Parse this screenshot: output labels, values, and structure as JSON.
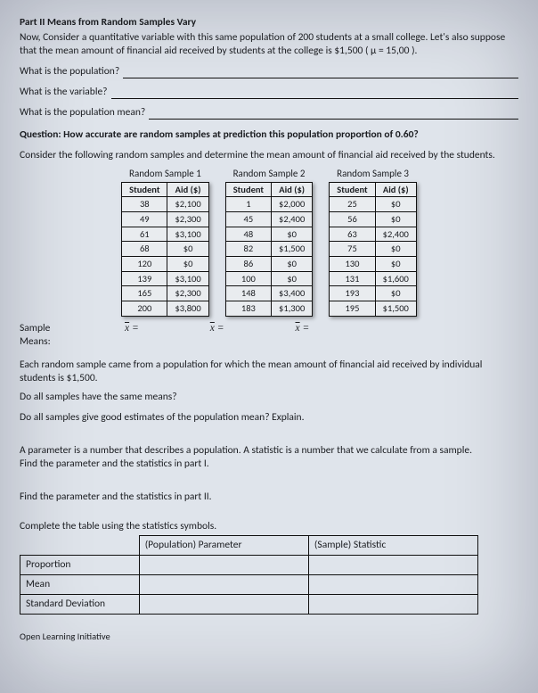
{
  "title": "Part II Means from Random Samples Vary",
  "intro": "Now, Consider a quantitative variable with this same population of 200 students at a small college. Let's also suppose that the mean amount of financial aid received by students at the college is $1,500 ( μ = 15,00 ).",
  "prompts": {
    "p1": "What is the population?",
    "p2": "What is the variable?",
    "p3": "What is the population mean?"
  },
  "question": "Question: How accurate are random samples at prediction this population proportion of 0.60?",
  "consider": "Consider the following random samples and determine the mean amount of financial aid received by the students.",
  "sampleTitles": {
    "t1": "Random Sample 1",
    "t2": "Random Sample 2",
    "t3": "Random Sample 3"
  },
  "headers": {
    "student": "Student",
    "aid": "Aid ($)"
  },
  "sample1": [
    {
      "s": "38",
      "a": "$2,100"
    },
    {
      "s": "49",
      "a": "$2,300"
    },
    {
      "s": "61",
      "a": "$3,100"
    },
    {
      "s": "68",
      "a": "$0"
    },
    {
      "s": "120",
      "a": "$0"
    },
    {
      "s": "139",
      "a": "$3,100"
    },
    {
      "s": "165",
      "a": "$2,300"
    },
    {
      "s": "200",
      "a": "$3,800"
    }
  ],
  "sample2": [
    {
      "s": "1",
      "a": "$2,000"
    },
    {
      "s": "45",
      "a": "$2,400"
    },
    {
      "s": "48",
      "a": "$0"
    },
    {
      "s": "82",
      "a": "$1,500"
    },
    {
      "s": "86",
      "a": "$0"
    },
    {
      "s": "100",
      "a": "$0"
    },
    {
      "s": "148",
      "a": "$3,400"
    },
    {
      "s": "183",
      "a": "$1,300"
    }
  ],
  "sample3": [
    {
      "s": "25",
      "a": "$0"
    },
    {
      "s": "56",
      "a": "$0"
    },
    {
      "s": "63",
      "a": "$2,400"
    },
    {
      "s": "75",
      "a": "$0"
    },
    {
      "s": "130",
      "a": "$0"
    },
    {
      "s": "131",
      "a": "$1,600"
    },
    {
      "s": "193",
      "a": "$0"
    },
    {
      "s": "195",
      "a": "$1,500"
    }
  ],
  "meansLabels": {
    "sample": "Sample",
    "means": "Means:",
    "eq": " ="
  },
  "notes": {
    "n1": "Each random sample came from a population for which the mean amount of financial aid received by individual students is $1,500.",
    "q1": "Do all samples have the same means?",
    "q2": "Do all samples give good estimates of the population mean? Explain.",
    "paramdef": "A parameter is a number that describes a population.  A statistic is a number that we calculate from a sample.",
    "findI": "Find the parameter and the statistics in part I.",
    "findII": "Find the parameter and the statistics in part II.",
    "completeTable": "Complete the table using the statistics symbols."
  },
  "symbolsTable": {
    "h1": "",
    "h2": "(Population) Parameter",
    "h3": "(Sample) Statistic",
    "r1": "Proportion",
    "r2": "Mean",
    "r3": "Standard Deviation"
  },
  "footer": "Open Learning Initiative"
}
